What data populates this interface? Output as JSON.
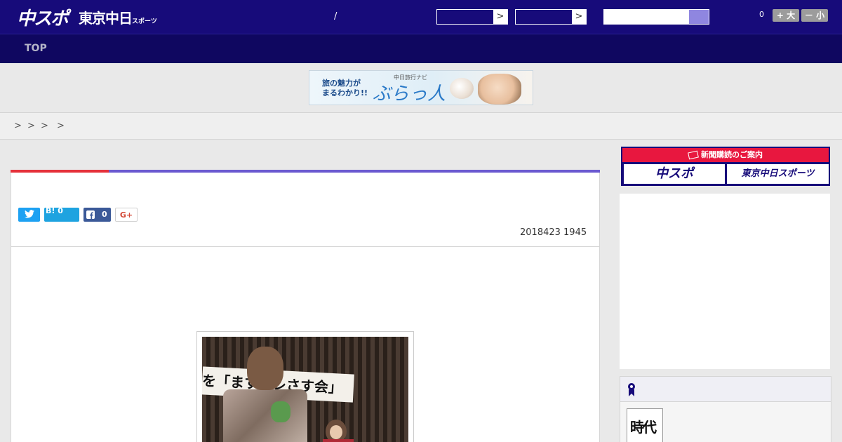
{
  "header": {
    "logo_chuspo": "中スポ",
    "logo_tokyo": "東京中日",
    "logo_tokyo_sub": "スポーツ",
    "separator": "/",
    "select_arrow_1": ">",
    "select_arrow_2": ">",
    "font_size_count": "0",
    "font_larger": "+ 大",
    "font_smaller": "－ 小"
  },
  "nav": {
    "top": "TOP"
  },
  "ad_banner": {
    "line1": "旅の魅力が",
    "line2": "まるわかり!!",
    "brand_small": "中日旅行ナビ",
    "brand": "ぶらっ人"
  },
  "breadcrumb": [
    ">",
    ">",
    ">",
    ">"
  ],
  "article": {
    "share_twitter": "",
    "share_hatena": "B! 0",
    "share_facebook_count": "0",
    "share_gplus": "G+",
    "date": "2018423 1945",
    "photo_sign": "を「ますテレさす会」"
  },
  "sidebar": {
    "subscription_title": "新聞購読のご案内",
    "subscribe_chuspo": "中スポ",
    "subscribe_tokyo": "東京中日スポーツ",
    "rank_thumb_text": "時代"
  },
  "colors": {
    "header_bg": "#170b7a",
    "nav_bg": "#0f0760",
    "accent_red": "#e5323b",
    "accent_purple": "#6b5ad0",
    "subscribe_red": "#e8173f"
  }
}
